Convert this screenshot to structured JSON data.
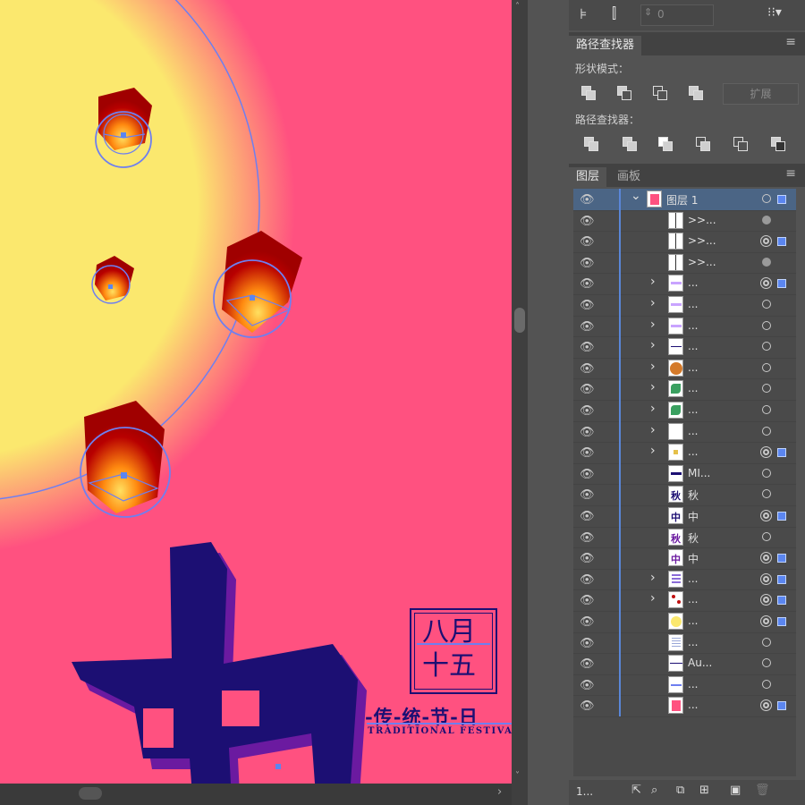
{
  "colors": {
    "canvas_bg": "#ff5180",
    "moon": "#fbe86e",
    "lantern_top": "#b30000",
    "lantern_glow": "#ffd040",
    "text_navy": "#1c0f73",
    "text_shadow": "#6b1aa0",
    "selection_blue": "#5b86f0",
    "panel_bg": "#535353"
  },
  "canvas": {
    "stamp_line1": "八月",
    "stamp_line2": "十五",
    "festival_cn": "-传-统-节-日",
    "festival_en": "TRADITIONAL FESTIVAL",
    "big_char": "中"
  },
  "toolbar": {
    "field_value": "0"
  },
  "pathfinder": {
    "tab_label": "路径查找器",
    "shape_modes_label": "形状模式：",
    "pathfinders_label": "路径查找器：",
    "expand_label": "扩展"
  },
  "layers_panel": {
    "tab_layers": "图层",
    "tab_artboards": "画板",
    "footer_count": "1...",
    "rows": [
      {
        "name": "图层 1",
        "chev": "v",
        "thumb": "pink",
        "target": "plain",
        "sel": true,
        "top": true
      },
      {
        "name": ">>...",
        "chev": "",
        "thumb": "lines",
        "target": "fill",
        "sel": false
      },
      {
        "name": ">>...",
        "chev": "",
        "thumb": "lines",
        "target": "dbl",
        "sel": true
      },
      {
        "name": ">>...",
        "chev": "",
        "thumb": "lines",
        "target": "fill",
        "sel": false
      },
      {
        "name": "...",
        "chev": ">",
        "thumb": "lilac",
        "target": "dbl",
        "sel": true
      },
      {
        "name": "...",
        "chev": ">",
        "thumb": "lilac",
        "target": "plain",
        "sel": false
      },
      {
        "name": "...",
        "chev": ">",
        "thumb": "lilac",
        "target": "plain",
        "sel": false
      },
      {
        "name": "...",
        "chev": ">",
        "thumb": "dash",
        "target": "plain",
        "sel": false
      },
      {
        "name": "...",
        "chev": ">",
        "thumb": "orange",
        "target": "plain",
        "sel": false
      },
      {
        "name": "...",
        "chev": ">",
        "thumb": "plant",
        "target": "plain",
        "sel": false
      },
      {
        "name": "...",
        "chev": ">",
        "thumb": "plant",
        "target": "plain",
        "sel": false
      },
      {
        "name": "...",
        "chev": ">",
        "thumb": "blank",
        "target": "plain",
        "sel": false
      },
      {
        "name": "...",
        "chev": ">",
        "thumb": "star",
        "target": "dbl",
        "sel": true
      },
      {
        "name": "MI...",
        "chev": "",
        "thumb": "text",
        "target": "plain",
        "sel": false
      },
      {
        "name": "秋",
        "chev": "",
        "thumb": "qiu",
        "target": "plain",
        "sel": false
      },
      {
        "name": "中",
        "chev": "",
        "thumb": "zhong",
        "target": "dbl",
        "sel": true
      },
      {
        "name": "秋",
        "chev": "",
        "thumb": "qiu2",
        "target": "plain",
        "sel": false
      },
      {
        "name": "中",
        "chev": "",
        "thumb": "zhong2",
        "target": "dbl",
        "sel": true
      },
      {
        "name": "...",
        "chev": ">",
        "thumb": "bars",
        "target": "dbl",
        "sel": true
      },
      {
        "name": "...",
        "chev": ">",
        "thumb": "dots",
        "target": "dbl",
        "sel": true
      },
      {
        "name": "...",
        "chev": "",
        "thumb": "moon",
        "target": "dbl",
        "sel": true
      },
      {
        "name": "...",
        "chev": "",
        "thumb": "bars2",
        "target": "plain",
        "sel": false
      },
      {
        "name": "Au...",
        "chev": "",
        "thumb": "dash2",
        "target": "plain",
        "sel": false
      },
      {
        "name": "...",
        "chev": "",
        "thumb": "dash3",
        "target": "plain",
        "sel": false
      },
      {
        "name": "...",
        "chev": "",
        "thumb": "pink",
        "target": "dbl",
        "sel": true
      }
    ]
  }
}
